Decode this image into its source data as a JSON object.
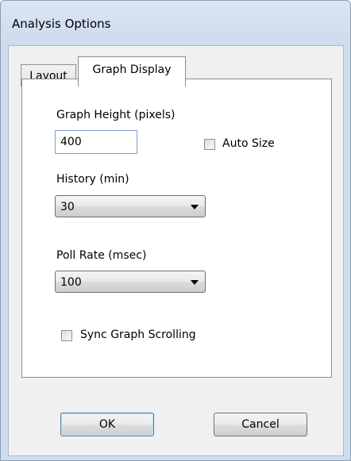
{
  "window": {
    "title": "Analysis Options"
  },
  "tabs": [
    {
      "label": "Layout",
      "selected": false
    },
    {
      "label": "Graph Display",
      "selected": true
    }
  ],
  "graph_display": {
    "graph_height_label": "Graph Height (pixels)",
    "graph_height_value": "400",
    "auto_size_label": "Auto Size",
    "auto_size_checked": false,
    "history_label": "History (min)",
    "history_value": "30",
    "poll_rate_label": "Poll Rate (msec)",
    "poll_rate_value": "100",
    "sync_scrolling_label": "Sync Graph Scrolling",
    "sync_scrolling_checked": false
  },
  "buttons": {
    "ok": "OK",
    "cancel": "Cancel"
  },
  "icons": {
    "combo_arrow": "chevron-down-icon"
  },
  "colors": {
    "title_bar": "#cfdcee",
    "client": "#f0f0f0",
    "panel": "#ffffff",
    "textbox_border": "#7a9cd3"
  }
}
